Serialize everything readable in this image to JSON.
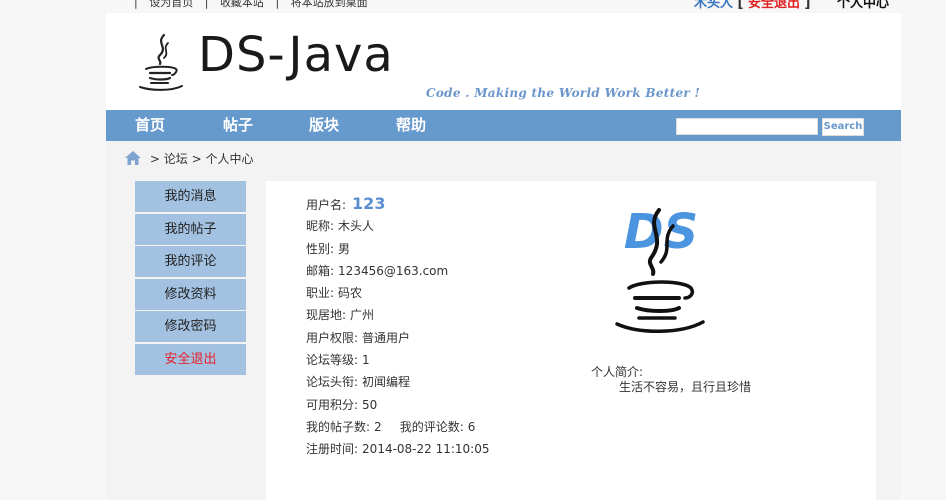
{
  "topbar": {
    "links": [
      "设为首页",
      "收藏本站",
      "将本站放到桌面"
    ],
    "username": "木头人",
    "logout_label": "安全退出",
    "user_center_label": "个人中心"
  },
  "header": {
    "logo_text": "DS-Java",
    "slogan": "Code . Making the World Work Better !"
  },
  "nav": {
    "items": [
      {
        "label": "首页"
      },
      {
        "label": "帖子"
      },
      {
        "label": "版块"
      },
      {
        "label": "帮助"
      }
    ],
    "search_value": "",
    "search_placeholder": "",
    "search_button_label": "Search",
    "accent_color": "#6699cc"
  },
  "breadcrumb": {
    "icon": "home-icon",
    "items": [
      "论坛",
      "个人中心"
    ],
    "separator": ">"
  },
  "sidebar": {
    "items": [
      {
        "label": "我的消息"
      },
      {
        "label": "我的帖子"
      },
      {
        "label": "我的评论"
      },
      {
        "label": "修改资料"
      },
      {
        "label": "修改密码"
      },
      {
        "label": "安全退出"
      }
    ]
  },
  "profile": {
    "username_label": "用户名:",
    "username": "123",
    "fields": [
      {
        "label": "昵称:",
        "value": "木头人"
      },
      {
        "label": "性别:",
        "value": "男"
      },
      {
        "label": "邮箱:",
        "value": "123456@163.com"
      },
      {
        "label": "职业:",
        "value": "码农"
      },
      {
        "label": "现居地:",
        "value": "广州"
      },
      {
        "label": "用户权限:",
        "value": "普通用户"
      },
      {
        "label": "论坛等级:",
        "value": "1"
      },
      {
        "label": "论坛头衔:",
        "value": "初闻编程"
      },
      {
        "label": "可用积分:",
        "value": "50"
      }
    ],
    "posts_label": "我的帖子数:",
    "posts_count": "2",
    "comments_label": "我的评论数:",
    "comments_count": "6",
    "register_label": "注册时间:",
    "register_time": "2014-08-22 11:10:05",
    "avatar_text": "DS",
    "bio_label": "个人简介:",
    "bio": "生活不容易，且行且珍惜"
  }
}
